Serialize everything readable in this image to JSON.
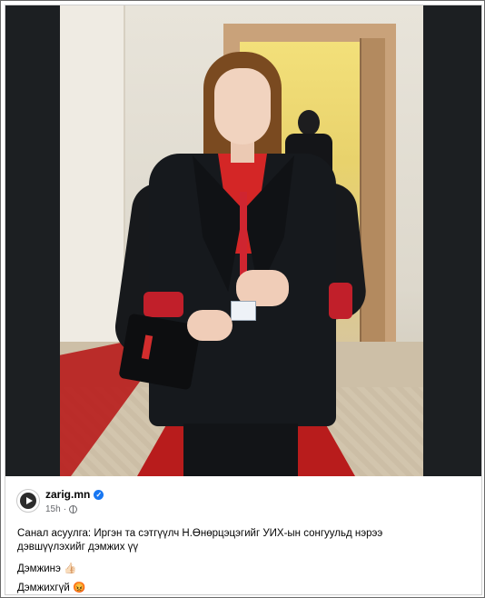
{
  "post": {
    "author": "zarig.mn",
    "verified_symbol": "✓",
    "time": "15h",
    "separator": "·",
    "privacy_icon": "globe-icon",
    "question": "Санал асуулга: Иргэн та сэтгүүлч Н.Өнөрцэцэгийг УИХ-ын сонгуульд нэрээ дэвшүүлэхийг дэмжих үү",
    "option_support": "Дэмжинэ 👍🏻",
    "option_oppose": "Дэмжихгүй 😡"
  },
  "colors": {
    "verified_blue": "#1877f2",
    "meta_gray": "#65676b",
    "text": "#050505"
  }
}
